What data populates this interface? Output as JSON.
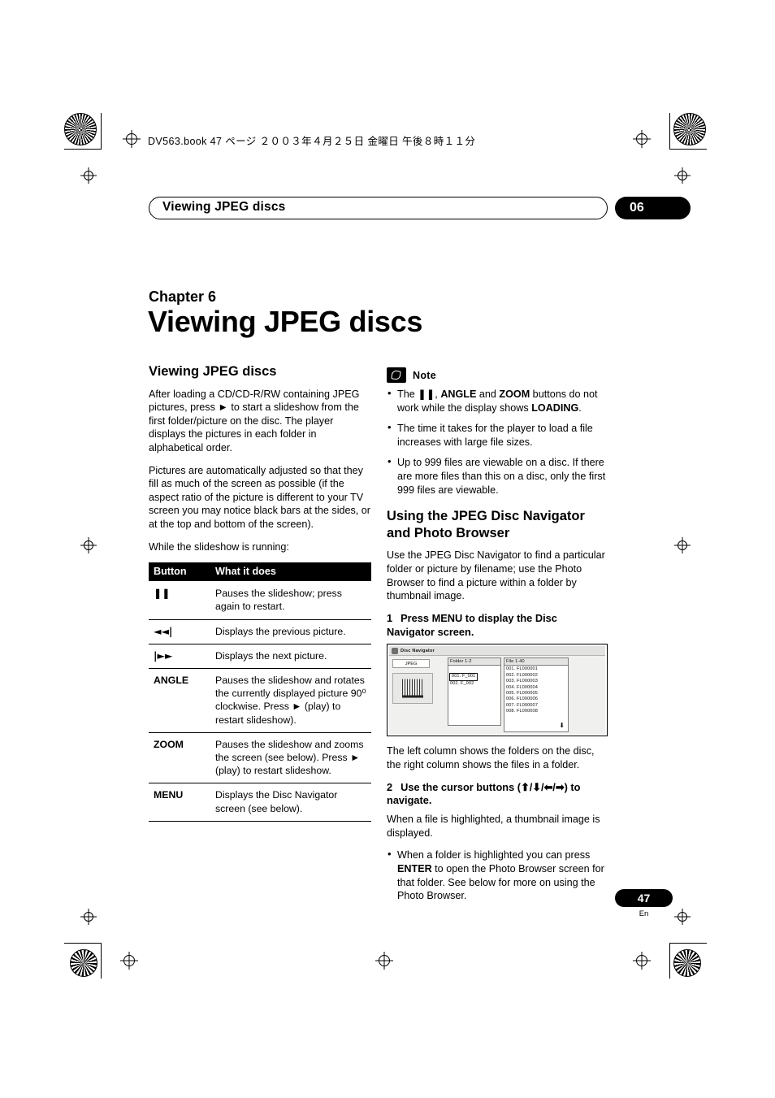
{
  "header": {
    "file_line": "DV563.book  47 ページ  ２００３年４月２５日   金曜日   午後８時１１分"
  },
  "running_head": {
    "title": "Viewing JPEG discs",
    "chapter_number": "06"
  },
  "title_block": {
    "kicker": "Chapter 6",
    "title": "Viewing JPEG discs"
  },
  "left_column": {
    "section_title": "Viewing JPEG discs",
    "paragraphs": [
      "After loading a CD/CD-R/RW containing JPEG pictures, press ► to start a slideshow from the first folder/picture on the disc. The player displays the pictures in each folder in alphabetical order.",
      "Pictures are automatically adjusted so that they fill as much of the screen as possible (if the aspect ratio of the picture is different to your TV screen you may notice black bars at the sides, or at the top and bottom of the screen).",
      "While the slideshow is running:"
    ],
    "table": {
      "headers": [
        "Button",
        "What it does"
      ],
      "rows": [
        {
          "button": "❚❚",
          "desc": "Pauses the slideshow; press again to restart."
        },
        {
          "button": "◄◄|",
          "desc": "Displays the previous picture."
        },
        {
          "button": "|►►",
          "desc": "Displays the next picture."
        },
        {
          "button": "ANGLE",
          "desc": "Pauses the slideshow and rotates the currently displayed picture 90⁰ clockwise. Press ► (play) to restart slideshow)."
        },
        {
          "button": "ZOOM",
          "desc": "Pauses the slideshow and zooms the screen (see below). Press ► (play) to restart slideshow."
        },
        {
          "button": "MENU",
          "desc": "Displays the Disc Navigator screen (see below)."
        }
      ]
    }
  },
  "right_column": {
    "note_label": "Note",
    "note_items": [
      "The ❚❚, ANGLE and ZOOM buttons do not work while the display shows LOADING.",
      "The time it takes for the player to load a file increases with large file sizes.",
      "Up to 999 files are viewable on a disc. If there are more files than this on a disc, only the first 999 files are viewable."
    ],
    "section_title": "Using the JPEG Disc Navigator and Photo Browser",
    "intro": "Use the JPEG Disc Navigator to find a particular folder or picture by filename; use the Photo Browser to find a picture within a folder by thumbnail image.",
    "step1_num": "1",
    "step1_text": "Press MENU to display the Disc Navigator screen.",
    "caption": "The left column shows the folders on the disc, the right column shows the files in a folder.",
    "step2_num": "2",
    "step2_text": "Use the cursor buttons (⬆/⬇/⬅/➡) to navigate.",
    "step2_body": "When a file is highlighted, a thumbnail image is displayed.",
    "bullet": "When a folder is highlighted you can press ENTER to open the Photo Browser screen for that folder. See below for more on using the Photo Browser."
  },
  "disc_navigator": {
    "window_title": "Disc Navigator",
    "disc_label": "JPEG",
    "folder_col_header": "Folder 1-2",
    "folders": [
      "001. F_001",
      "002. F_002"
    ],
    "file_col_header": "File 1-40",
    "files": [
      "001. FL000001",
      "002. FL000002",
      "003. FL000003",
      "004. FL000004",
      "005. FL000005",
      "006. FL000006",
      "007. FL000007",
      "008. FL000008"
    ],
    "scroll_arrow": "⬇"
  },
  "footer": {
    "page_number": "47",
    "language": "En"
  }
}
